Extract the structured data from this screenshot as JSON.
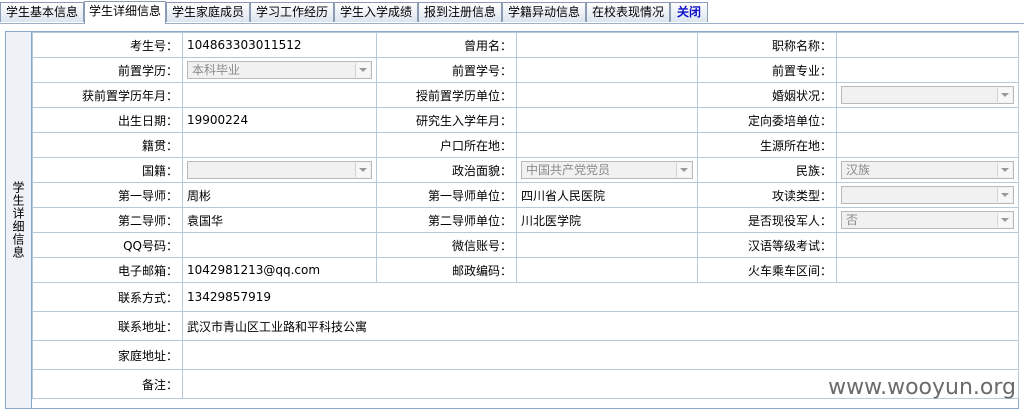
{
  "tabs": [
    {
      "label": "学生基本信息"
    },
    {
      "label": "学生详细信息"
    },
    {
      "label": "学生家庭成员"
    },
    {
      "label": "学习工作经历"
    },
    {
      "label": "学生入学成绩"
    },
    {
      "label": "报到注册信息"
    },
    {
      "label": "学籍异动信息"
    },
    {
      "label": "在校表现情况"
    },
    {
      "label": "关闭"
    }
  ],
  "side_title": "学生详细信息",
  "fields": {
    "ksh": {
      "label": "考生号：",
      "value": "104863303011512"
    },
    "cym": {
      "label": "曾用名：",
      "value": ""
    },
    "zcmc": {
      "label": "职称名称：",
      "value": ""
    },
    "qzxl": {
      "label": "前置学历：",
      "value": "本科毕业"
    },
    "qzxh": {
      "label": "前置学号：",
      "value": ""
    },
    "qzzy": {
      "label": "前置专业：",
      "value": ""
    },
    "hqxlny": {
      "label": "获前置学历年月：",
      "value": ""
    },
    "sqxldw": {
      "label": "授前置学历单位：",
      "value": ""
    },
    "hyzk": {
      "label": "婚姻状况：",
      "value": ""
    },
    "csrq": {
      "label": "出生日期：",
      "value": "19900224"
    },
    "yjsrxny": {
      "label": "研究生入学年月：",
      "value": ""
    },
    "dxwpdw": {
      "label": "定向委培单位：",
      "value": ""
    },
    "jg": {
      "label": "籍贯：",
      "value": ""
    },
    "hkszd": {
      "label": "户口所在地：",
      "value": ""
    },
    "sydszd": {
      "label": "生源所在地：",
      "value": ""
    },
    "gj": {
      "label": "国籍：",
      "value": ""
    },
    "zzmm": {
      "label": "政治面貌：",
      "value": "中国共产党党员"
    },
    "mz": {
      "label": "民族：",
      "value": "汉族"
    },
    "dyds": {
      "label": "第一导师：",
      "value": "周彬"
    },
    "dydsdw": {
      "label": "第一导师单位：",
      "value": "四川省人民医院"
    },
    "gdlx": {
      "label": "攻读类型：",
      "value": ""
    },
    "deds": {
      "label": "第二导师：",
      "value": "袁国华"
    },
    "dedsdw": {
      "label": "第二导师单位：",
      "value": "川北医学院"
    },
    "sfxyjr": {
      "label": "是否现役军人：",
      "value": "否"
    },
    "qq": {
      "label": "QQ号码：",
      "value": ""
    },
    "wx": {
      "label": "微信账号：",
      "value": ""
    },
    "hydj": {
      "label": "汉语等级考试：",
      "value": ""
    },
    "email": {
      "label": "电子邮箱：",
      "value": "1042981213@qq.com"
    },
    "yzbm": {
      "label": "邮政编码：",
      "value": ""
    },
    "hcqj": {
      "label": "火车乘车区间：",
      "value": ""
    },
    "lxfs": {
      "label": "联系方式：",
      "value": "13429857919"
    },
    "lxdz": {
      "label": "联系地址：",
      "value": "武汉市青山区工业路和平科技公寓"
    },
    "jtdz": {
      "label": "家庭地址：",
      "value": ""
    },
    "bz": {
      "label": "备注：",
      "value": ""
    }
  },
  "watermark": "www.wooyun.org"
}
